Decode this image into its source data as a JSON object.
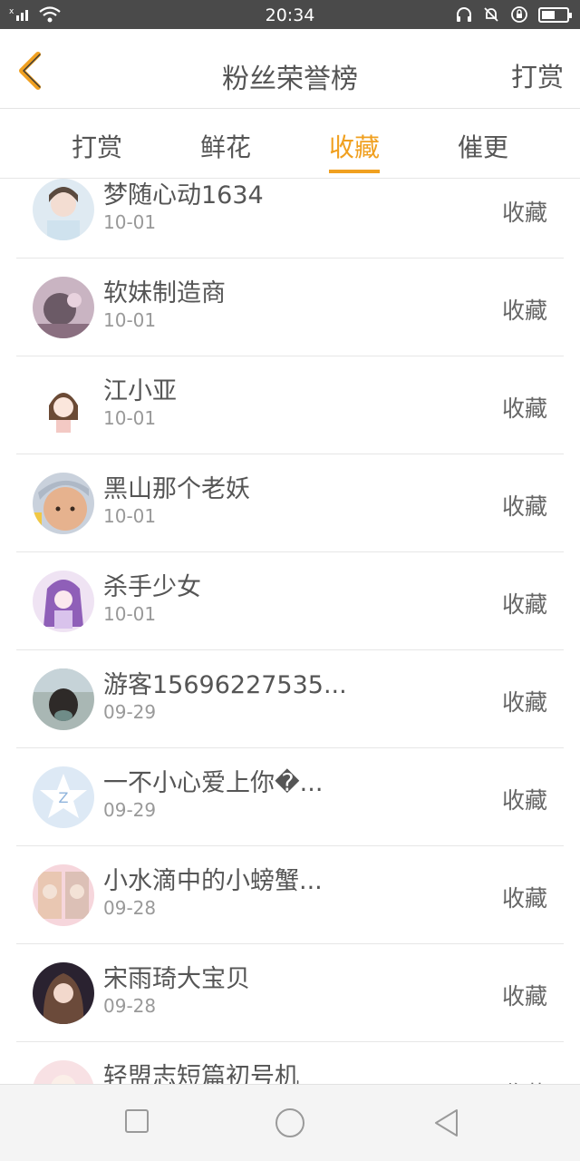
{
  "status": {
    "time": "20:34",
    "battery_level": 0.45
  },
  "header": {
    "title": "粉丝荣誉榜",
    "action": "打赏"
  },
  "tabs": [
    {
      "label": "打赏",
      "active": false
    },
    {
      "label": "鲜花",
      "active": false
    },
    {
      "label": "收藏",
      "active": true
    },
    {
      "label": "催更",
      "active": false
    }
  ],
  "rows": [
    {
      "name": "梦随心动1634",
      "date": "10-01",
      "action": "收藏"
    },
    {
      "name": "软妹制造商",
      "date": "10-01",
      "action": "收藏"
    },
    {
      "name": "江小亚",
      "date": "10-01",
      "action": "收藏"
    },
    {
      "name": "黑山那个老妖",
      "date": "10-01",
      "action": "收藏"
    },
    {
      "name": "杀手少女",
      "date": "10-01",
      "action": "收藏"
    },
    {
      "name": "游客15696227535...",
      "date": "09-29",
      "action": "收藏"
    },
    {
      "name": "一不小心爱上你�...",
      "date": "09-29",
      "action": "收藏"
    },
    {
      "name": "小水滴中的小螃蟹...",
      "date": "09-28",
      "action": "收藏"
    },
    {
      "name": "宋雨琦大宝贝",
      "date": "09-28",
      "action": "收藏"
    },
    {
      "name": "轻盟志短篇初号机",
      "date": "",
      "action": "收藏"
    }
  ],
  "colors": {
    "accent": "#f0a020",
    "back_arrow": "#f0a020"
  }
}
